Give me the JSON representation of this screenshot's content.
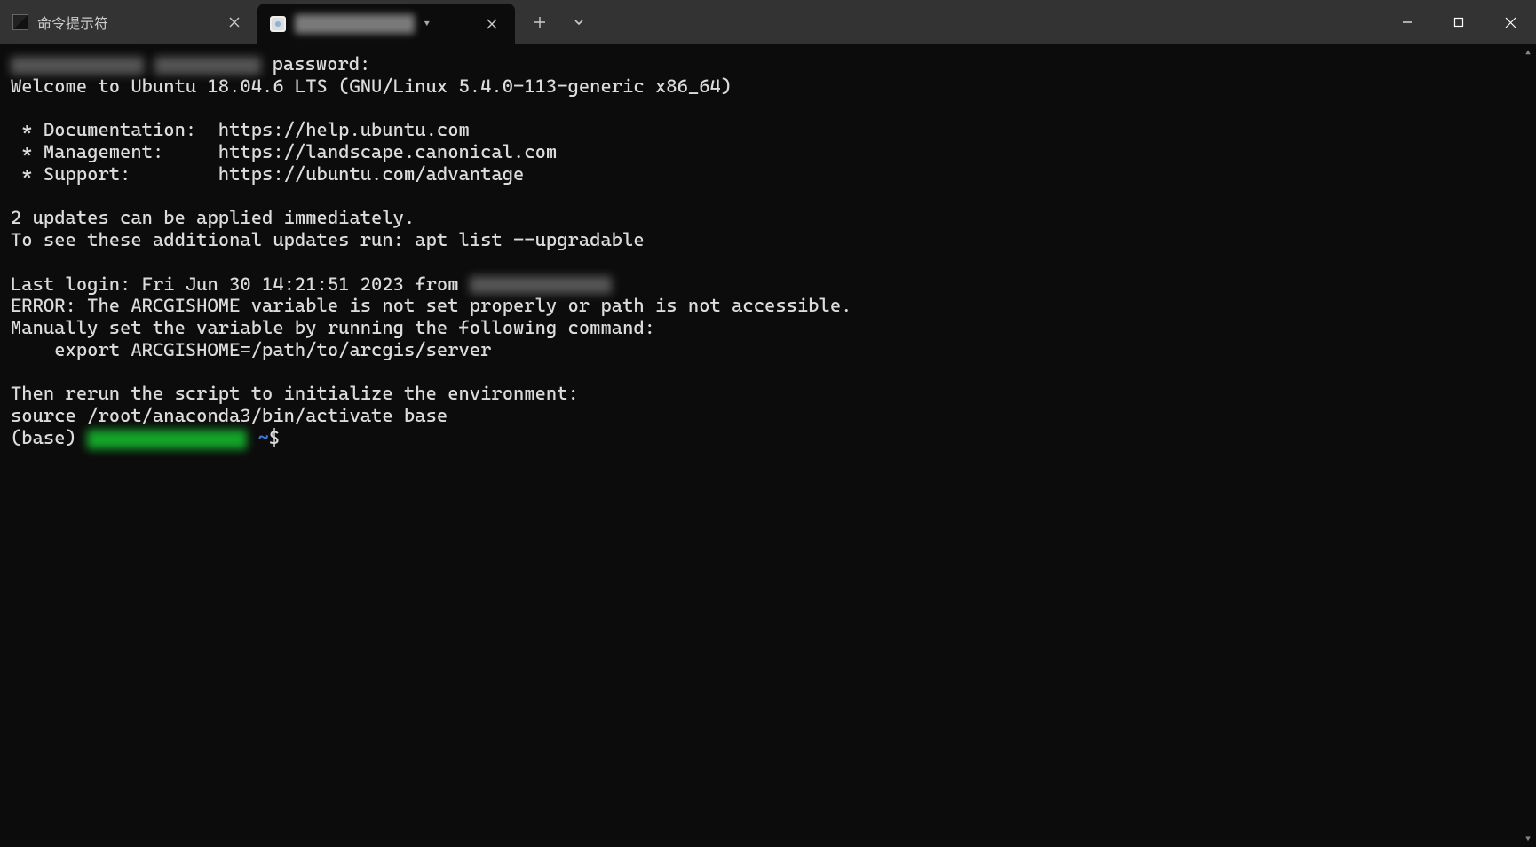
{
  "titlebar": {
    "tabs": [
      {
        "label": "命令提示符",
        "active": false
      },
      {
        "label": "[redacted]",
        "active": true
      }
    ],
    "new_tab_tooltip": "New tab",
    "dropdown_tooltip": "Tab options"
  },
  "window_controls": {
    "minimize": "minimize",
    "maximize": "maximize",
    "close": "close"
  },
  "terminal": {
    "line_password_prefix_redacted": "                        ",
    "line_password_suffix": " password:",
    "line_welcome": "Welcome to Ubuntu 18.04.6 LTS (GNU/Linux 5.4.0-113-generic x86_64)",
    "line_doc": " * Documentation:  https://help.ubuntu.com",
    "line_mgmt": " * Management:     https://landscape.canonical.com",
    "line_support": " * Support:        https://ubuntu.com/advantage",
    "line_updates1": "2 updates can be applied immediately.",
    "line_updates2": "To see these additional updates run: apt list --upgradable",
    "line_last_login_prefix": "Last login: Fri Jun 30 14:21:51 2023 from ",
    "line_error": "ERROR: The ARCGISHOME variable is not set properly or path is not accessible.",
    "line_manual": "Manually set the variable by running the following command:",
    "line_export": "    export ARCGISHOME=/path/to/arcgis/server",
    "line_rerun": "Then rerun the script to initialize the environment:",
    "line_source": "source /root/anaconda3/bin/activate base",
    "prompt_env": "(base) ",
    "prompt_tilde": "~",
    "prompt_dollar": "$ "
  }
}
